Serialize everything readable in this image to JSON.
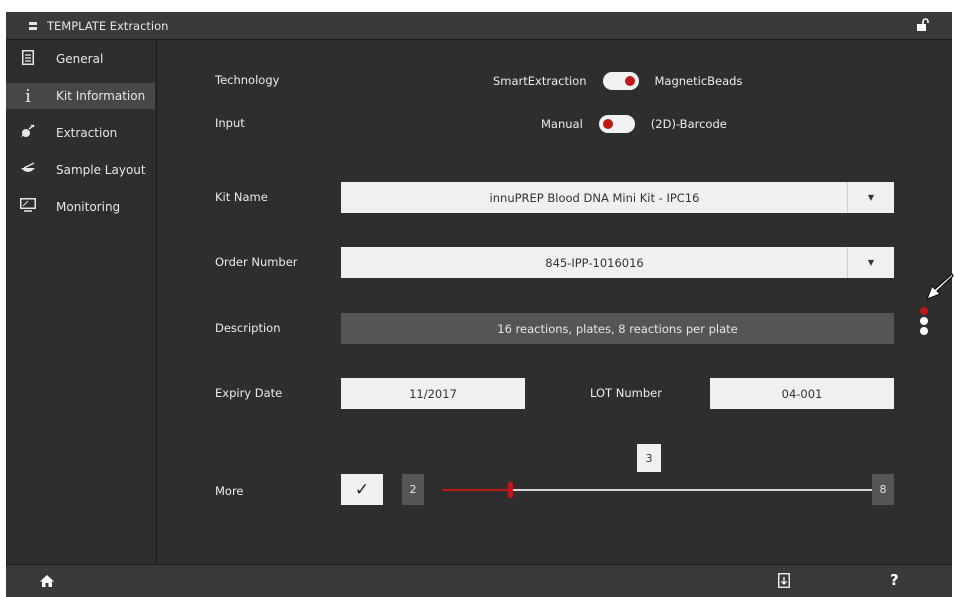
{
  "window": {
    "title": "TEMPLATE Extraction"
  },
  "sidebar": {
    "items": [
      {
        "label": "General",
        "icon": "document-icon"
      },
      {
        "label": "Kit Information",
        "icon": "info-icon",
        "active": true
      },
      {
        "label": "Extraction",
        "icon": "extraction-icon"
      },
      {
        "label": "Sample Layout",
        "icon": "sample-layout-icon"
      },
      {
        "label": "Monitoring",
        "icon": "monitor-icon"
      }
    ]
  },
  "form": {
    "technology": {
      "label": "Technology",
      "left": "SmartExtraction",
      "right": "MagneticBeads",
      "selected": "MagneticBeads"
    },
    "input": {
      "label": "Input",
      "left": "Manual",
      "right": "(2D)-Barcode",
      "selected": "Manual"
    },
    "kit_name": {
      "label": "Kit Name",
      "value": "innuPREP Blood DNA Mini Kit - IPC16"
    },
    "order_number": {
      "label": "Order Number",
      "value": "845-IPP-1016016"
    },
    "description": {
      "label": "Description",
      "value": "16 reactions, plates, 8 reactions per plate"
    },
    "expiry_date": {
      "label": "Expiry Date",
      "value": "11/2017"
    },
    "lot_number": {
      "label": "LOT Number",
      "value": "04-001"
    },
    "more": {
      "label": "More",
      "checked": true,
      "min": "2",
      "max": "8",
      "value": "3"
    }
  },
  "colors": {
    "accent": "#c01818",
    "background": "#2e2e2e",
    "bar": "#3a3a3a",
    "field": "#f0f0f0"
  }
}
